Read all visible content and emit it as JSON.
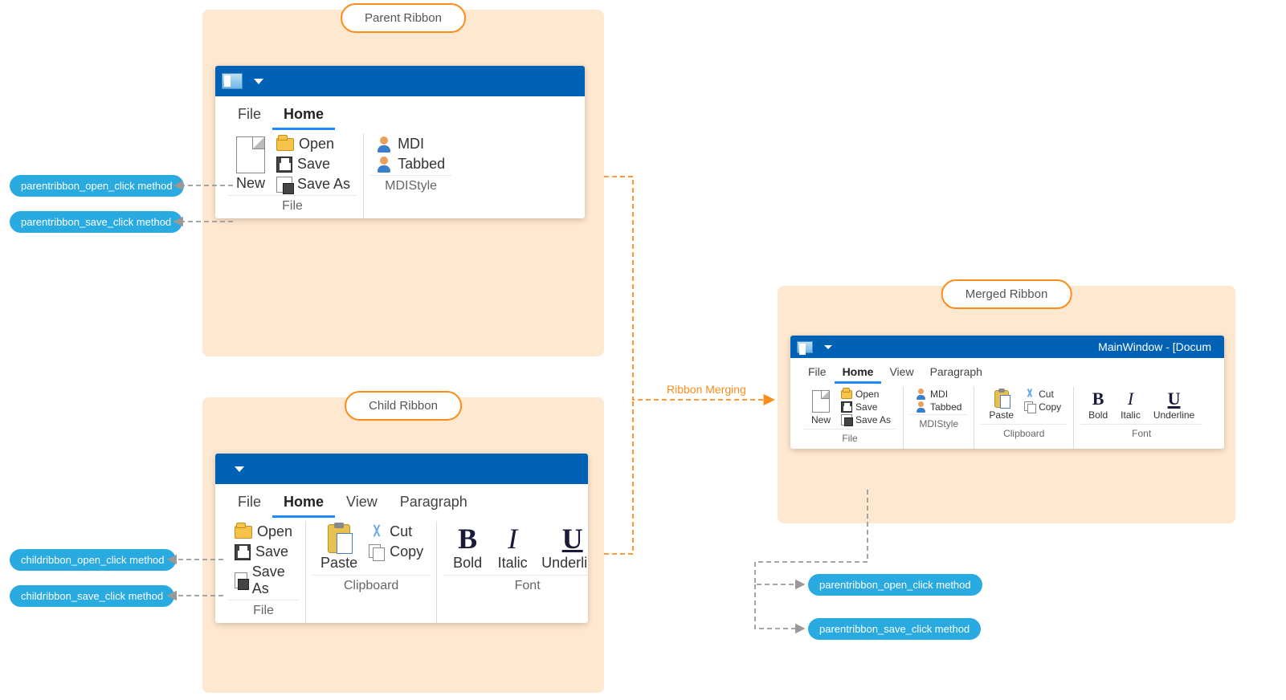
{
  "labels": {
    "parent": "Parent Ribbon",
    "child": "Child Ribbon",
    "merged": "Merged Ribbon",
    "merging": "Ribbon Merging"
  },
  "methods": {
    "p_open": "parentribbon_open_click method",
    "p_save": "parentribbon_save_click method",
    "c_open": "childribbon_open_click method",
    "c_save": "childribbon_save_click method",
    "m_open": "parentribbon_open_click method",
    "m_save": "parentribbon_save_click method"
  },
  "parent": {
    "tabs": {
      "file": "File",
      "home": "Home"
    },
    "file_group": {
      "new": "New",
      "open": "Open",
      "save": "Save",
      "saveas": "Save As",
      "footer": "File"
    },
    "mdi_group": {
      "mdi": "MDI",
      "tabbed": "Tabbed",
      "footer": "MDIStyle"
    }
  },
  "child": {
    "tabs": {
      "file": "File",
      "home": "Home",
      "view": "View",
      "paragraph": "Paragraph"
    },
    "file_group": {
      "open": "Open",
      "save": "Save",
      "saveas": "Save As",
      "footer": "File"
    },
    "clip_group": {
      "paste": "Paste",
      "cut": "Cut",
      "copy": "Copy",
      "footer": "Clipboard"
    },
    "font_group": {
      "bold": "Bold",
      "italic": "Italic",
      "underline": "Underline",
      "footer": "Font"
    }
  },
  "merged": {
    "title": "MainWindow - [Docum",
    "tabs": {
      "file": "File",
      "home": "Home",
      "view": "View",
      "paragraph": "Paragraph"
    },
    "file_group": {
      "new": "New",
      "open": "Open",
      "save": "Save",
      "saveas": "Save As",
      "footer": "File"
    },
    "mdi_group": {
      "mdi": "MDI",
      "tabbed": "Tabbed",
      "footer": "MDIStyle"
    },
    "clip_group": {
      "paste": "Paste",
      "cut": "Cut",
      "copy": "Copy",
      "footer": "Clipboard"
    },
    "font_group": {
      "bold": "Bold",
      "italic": "Italic",
      "underline": "Underline",
      "footer": "Font"
    }
  }
}
